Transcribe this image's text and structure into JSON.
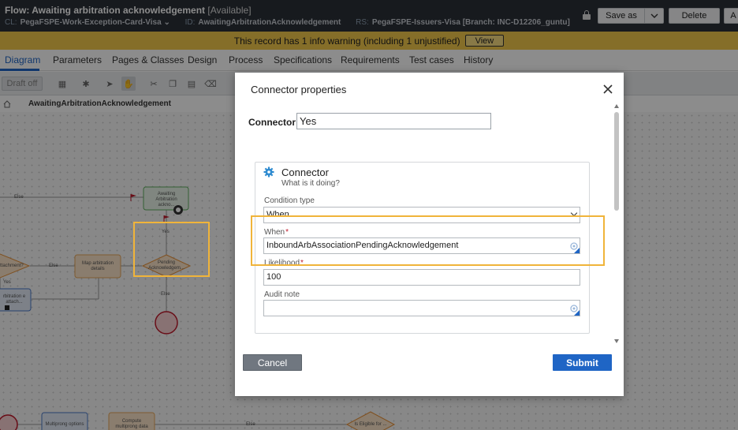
{
  "header": {
    "title": "Flow: Awaiting arbitration acknowledgement",
    "availability": "[Available]",
    "class_key": "CL:",
    "class_value": "PegaFSPE-Work-Exception-Card-Visa",
    "id_key": "ID:",
    "id_value": "AwaitingArbitrationAcknowledgement",
    "rs_key": "RS:",
    "rs_value": "PegaFSPE-Issuers-Visa [Branch: INC-D12206_guntu]",
    "save_as_label": "Save as",
    "delete_label": "Delete",
    "truncated_button_label": "A"
  },
  "warning": {
    "text": "This record has 1 info warning (including 1 unjustified)",
    "view_label": "View"
  },
  "tabs": [
    {
      "label": "Diagram"
    },
    {
      "label": "Parameters"
    },
    {
      "label": "Pages & Classes"
    },
    {
      "label": "Design"
    },
    {
      "label": "Process"
    },
    {
      "label": "Specifications"
    },
    {
      "label": "Requirements"
    },
    {
      "label": "Test cases"
    },
    {
      "label": "History"
    }
  ],
  "toolbar": {
    "draft_label": "Draft off"
  },
  "breadcrumb": {
    "label": "AwaitingArbitrationAcknowledgement"
  },
  "canvas": {
    "labels": {
      "else_1": "Else",
      "awaiting": "Awaiting Arbitration ackno...",
      "yes_1": "Yes",
      "pending": "Pending Acknowledgem...",
      "attachment": "ttachment?",
      "else_2": "Else",
      "map_arb": "Map arbitration details",
      "yes_2": "Yes",
      "rbitration": "rbitration e attach...",
      "else_3": "Else",
      "multiprong": "Multiprong options",
      "compute": "Compute multiprong data",
      "else_4": "Else",
      "eligible": "Is Eligible for ..."
    }
  },
  "modal": {
    "title": "Connector properties",
    "connector_label": "Connector:",
    "connector_value": "Yes",
    "section_title": "Connector",
    "section_subtitle": "What is it doing?",
    "condition_type_label": "Condition type",
    "condition_type_value": "When",
    "when_label": "When",
    "when_required": "*",
    "when_value": "InboundArbAssociationPendingAcknowledgement",
    "likelihood_label": "Likelihood",
    "likelihood_required": "*",
    "likelihood_value": "100",
    "audit_note_label": "Audit note",
    "audit_note_value": "",
    "cancel_label": "Cancel",
    "submit_label": "Submit"
  },
  "colors": {
    "header_bg": "#2b3038",
    "warning_bg": "#f2c84b",
    "accent_blue": "#1f65c5",
    "highlight_orange": "#f0b43a",
    "cancel_gray": "#707780"
  }
}
